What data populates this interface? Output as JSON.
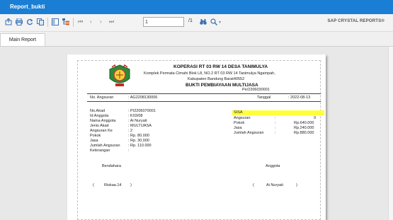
{
  "window": {
    "title": "Report_bukti"
  },
  "toolbar": {
    "page_value": "1",
    "page_total": "/1",
    "brand": "SAP CRYSTAL REPORTS®"
  },
  "tabs": [
    {
      "label": "Main Report"
    }
  ],
  "report": {
    "org_name": "KOPERASI RT 03 RW 14 DESA TANIMULYA",
    "address_line1": "Komplek Permata Cimahi Blok L8, NO.2 RT 03 RW 14 Tanimulya Ngampah,",
    "address_line2": "Kabupaten Bandung Barat40552",
    "doc_title": "BUKTI PEMBIAYAAN MULTIJASA",
    "doc_number": "Pe/2206030001",
    "no_angsuran_label": "No. Angsuran",
    "no_angsuran_value": ": AG2208130006",
    "tanggal_label": "Tanggal",
    "tanggal_value": ": 2022-08-13",
    "left_fields": [
      {
        "label": "No.Akad",
        "value": ": PI2206070001"
      },
      {
        "label": "Id Anggota",
        "value": ": K03/08"
      },
      {
        "label": "Nama Anggota",
        "value": ": Ai Nuryati"
      },
      {
        "label": "Jenis Akad",
        "value": ": MULTIJASA"
      },
      {
        "label": "Angsuran Ke",
        "value": ": 2"
      },
      {
        "label": "Pokok",
        "value": ": Rp. 80.000"
      },
      {
        "label": "Jasa",
        "value": ": Rp. 30.000"
      },
      {
        "label": "Jumlah Angsuran",
        "value": ": Rp. 110.000"
      },
      {
        "label": "Keterangan",
        "value": ":"
      }
    ],
    "sisa_label": "SISA",
    "right_fields": [
      {
        "label": "Angsuran",
        "colon": ":",
        "value": "9"
      },
      {
        "label": "Pokok",
        "colon": ":",
        "value": "Rp.640.000"
      },
      {
        "label": "Jasa",
        "colon": ":",
        "value": "Rp.240.000"
      },
      {
        "label": "Jumlah Angsuran",
        "colon": ":",
        "value": "Rp.880.000"
      }
    ],
    "bendahara_label": "Bendahara",
    "anggota_label": "Anggota",
    "bendahara_name": "Riskaa.14",
    "anggota_name": "Ai Nuryati",
    "paren_open": "(",
    "paren_close": ")"
  },
  "colors": {
    "titlebar": "#1a7fd4",
    "highlight": "#ffff3a"
  },
  "icons": [
    "export-icon",
    "print-icon",
    "refresh-icon",
    "copy-icon",
    "toggle-tree-icon",
    "group-tree-icon",
    "first-page-icon",
    "prev-page-icon",
    "next-page-icon",
    "last-page-icon",
    "binoculars-icon",
    "zoom-icon"
  ]
}
